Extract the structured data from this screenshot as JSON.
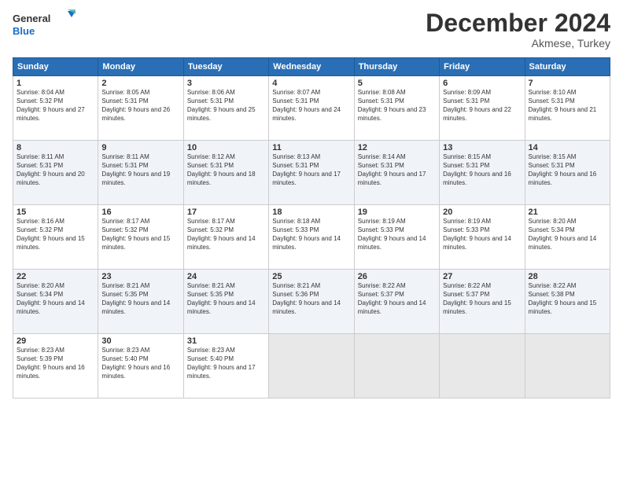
{
  "header": {
    "logo_general": "General",
    "logo_blue": "Blue",
    "month": "December 2024",
    "location": "Akmese, Turkey"
  },
  "days_of_week": [
    "Sunday",
    "Monday",
    "Tuesday",
    "Wednesday",
    "Thursday",
    "Friday",
    "Saturday"
  ],
  "weeks": [
    [
      {
        "day": "1",
        "sunrise": "8:04 AM",
        "sunset": "5:32 PM",
        "daylight": "9 hours and 27 minutes."
      },
      {
        "day": "2",
        "sunrise": "8:05 AM",
        "sunset": "5:31 PM",
        "daylight": "9 hours and 26 minutes."
      },
      {
        "day": "3",
        "sunrise": "8:06 AM",
        "sunset": "5:31 PM",
        "daylight": "9 hours and 25 minutes."
      },
      {
        "day": "4",
        "sunrise": "8:07 AM",
        "sunset": "5:31 PM",
        "daylight": "9 hours and 24 minutes."
      },
      {
        "day": "5",
        "sunrise": "8:08 AM",
        "sunset": "5:31 PM",
        "daylight": "9 hours and 23 minutes."
      },
      {
        "day": "6",
        "sunrise": "8:09 AM",
        "sunset": "5:31 PM",
        "daylight": "9 hours and 22 minutes."
      },
      {
        "day": "7",
        "sunrise": "8:10 AM",
        "sunset": "5:31 PM",
        "daylight": "9 hours and 21 minutes."
      }
    ],
    [
      {
        "day": "8",
        "sunrise": "8:11 AM",
        "sunset": "5:31 PM",
        "daylight": "9 hours and 20 minutes."
      },
      {
        "day": "9",
        "sunrise": "8:11 AM",
        "sunset": "5:31 PM",
        "daylight": "9 hours and 19 minutes."
      },
      {
        "day": "10",
        "sunrise": "8:12 AM",
        "sunset": "5:31 PM",
        "daylight": "9 hours and 18 minutes."
      },
      {
        "day": "11",
        "sunrise": "8:13 AM",
        "sunset": "5:31 PM",
        "daylight": "9 hours and 17 minutes."
      },
      {
        "day": "12",
        "sunrise": "8:14 AM",
        "sunset": "5:31 PM",
        "daylight": "9 hours and 17 minutes."
      },
      {
        "day": "13",
        "sunrise": "8:15 AM",
        "sunset": "5:31 PM",
        "daylight": "9 hours and 16 minutes."
      },
      {
        "day": "14",
        "sunrise": "8:15 AM",
        "sunset": "5:31 PM",
        "daylight": "9 hours and 16 minutes."
      }
    ],
    [
      {
        "day": "15",
        "sunrise": "8:16 AM",
        "sunset": "5:32 PM",
        "daylight": "9 hours and 15 minutes."
      },
      {
        "day": "16",
        "sunrise": "8:17 AM",
        "sunset": "5:32 PM",
        "daylight": "9 hours and 15 minutes."
      },
      {
        "day": "17",
        "sunrise": "8:17 AM",
        "sunset": "5:32 PM",
        "daylight": "9 hours and 14 minutes."
      },
      {
        "day": "18",
        "sunrise": "8:18 AM",
        "sunset": "5:33 PM",
        "daylight": "9 hours and 14 minutes."
      },
      {
        "day": "19",
        "sunrise": "8:19 AM",
        "sunset": "5:33 PM",
        "daylight": "9 hours and 14 minutes."
      },
      {
        "day": "20",
        "sunrise": "8:19 AM",
        "sunset": "5:33 PM",
        "daylight": "9 hours and 14 minutes."
      },
      {
        "day": "21",
        "sunrise": "8:20 AM",
        "sunset": "5:34 PM",
        "daylight": "9 hours and 14 minutes."
      }
    ],
    [
      {
        "day": "22",
        "sunrise": "8:20 AM",
        "sunset": "5:34 PM",
        "daylight": "9 hours and 14 minutes."
      },
      {
        "day": "23",
        "sunrise": "8:21 AM",
        "sunset": "5:35 PM",
        "daylight": "9 hours and 14 minutes."
      },
      {
        "day": "24",
        "sunrise": "8:21 AM",
        "sunset": "5:35 PM",
        "daylight": "9 hours and 14 minutes."
      },
      {
        "day": "25",
        "sunrise": "8:21 AM",
        "sunset": "5:36 PM",
        "daylight": "9 hours and 14 minutes."
      },
      {
        "day": "26",
        "sunrise": "8:22 AM",
        "sunset": "5:37 PM",
        "daylight": "9 hours and 14 minutes."
      },
      {
        "day": "27",
        "sunrise": "8:22 AM",
        "sunset": "5:37 PM",
        "daylight": "9 hours and 15 minutes."
      },
      {
        "day": "28",
        "sunrise": "8:22 AM",
        "sunset": "5:38 PM",
        "daylight": "9 hours and 15 minutes."
      }
    ],
    [
      {
        "day": "29",
        "sunrise": "8:23 AM",
        "sunset": "5:39 PM",
        "daylight": "9 hours and 16 minutes."
      },
      {
        "day": "30",
        "sunrise": "8:23 AM",
        "sunset": "5:40 PM",
        "daylight": "9 hours and 16 minutes."
      },
      {
        "day": "31",
        "sunrise": "8:23 AM",
        "sunset": "5:40 PM",
        "daylight": "9 hours and 17 minutes."
      },
      null,
      null,
      null,
      null
    ]
  ],
  "labels": {
    "sunrise": "Sunrise:",
    "sunset": "Sunset:",
    "daylight": "Daylight:"
  }
}
